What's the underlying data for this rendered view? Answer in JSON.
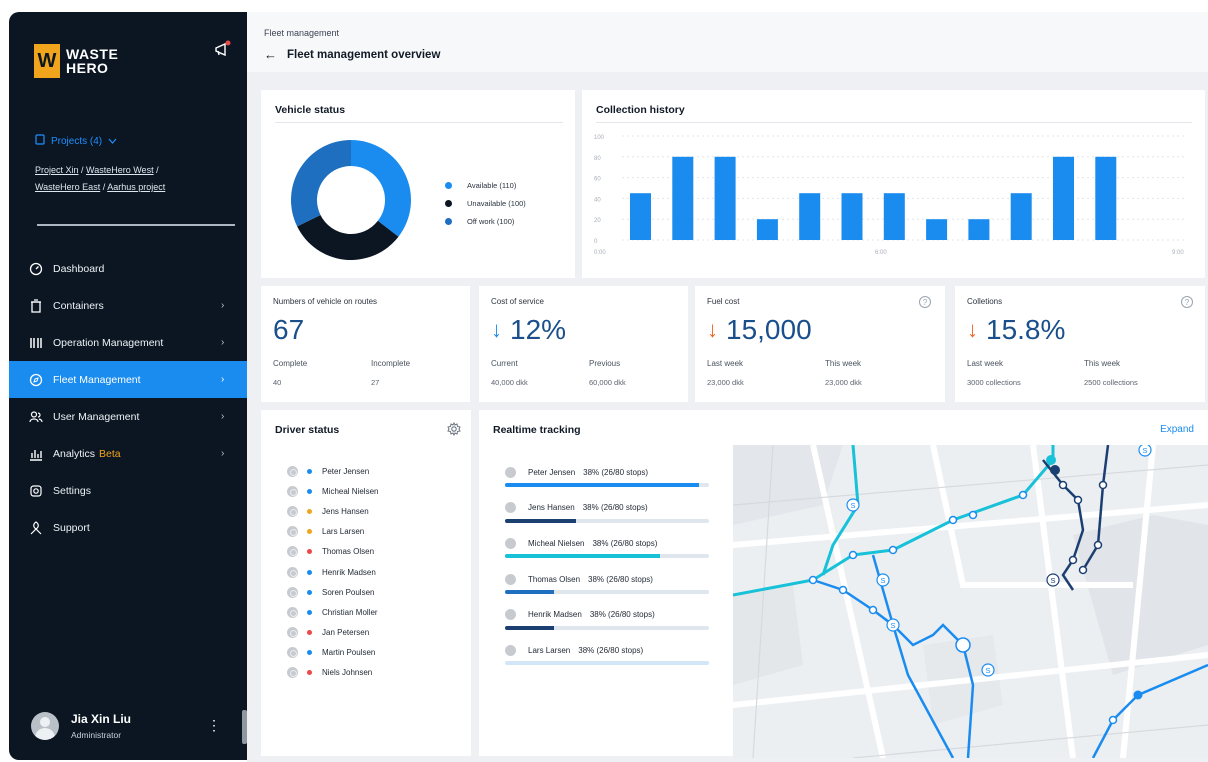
{
  "brand": {
    "logo_mark": "W",
    "logo_line1": "WASTE",
    "logo_line2": "HERO"
  },
  "sidebar": {
    "projects_label": "Projects (4)",
    "project_links": [
      "Project Xin",
      "WasteHero West",
      "WasteHero East",
      "Aarhus project"
    ],
    "items": [
      {
        "label": "Dashboard",
        "icon": "dashboard-icon"
      },
      {
        "label": "Containers",
        "icon": "container-icon",
        "chevron": "›"
      },
      {
        "label": "Operation Management",
        "icon": "operation-icon",
        "chevron": "›"
      },
      {
        "label": "Fleet Management",
        "icon": "fleet-icon",
        "chevron": "›",
        "active": true
      },
      {
        "label": "User Management",
        "icon": "users-icon",
        "chevron": "›"
      },
      {
        "label": "Analytics",
        "badge": "Beta",
        "icon": "analytics-icon",
        "chevron": "›"
      },
      {
        "label": "Settings",
        "icon": "gear-icon"
      },
      {
        "label": "Support",
        "icon": "support-icon"
      }
    ],
    "user": {
      "name": "Jia Xin Liu",
      "role": "Administrator"
    }
  },
  "header": {
    "breadcrumb": "Fleet management",
    "title": "Fleet management overview"
  },
  "vehicle_status": {
    "title": "Vehicle status",
    "legend": [
      {
        "label": "Available (110)",
        "color": "#1a8cf0",
        "value": 110
      },
      {
        "label": "Unavailable (100)",
        "color": "#0b1622",
        "value": 100
      },
      {
        "label": "Off work (100)",
        "color": "#1e6fbf",
        "value": 100
      }
    ]
  },
  "collection_history": {
    "title": "Collection history",
    "x_ticks": [
      "0:00",
      "6:00",
      "9:00"
    ]
  },
  "chart_data": {
    "type": "bar",
    "title": "Collection history",
    "ylim": [
      0,
      100
    ],
    "y_ticks": [
      0,
      20,
      40,
      60,
      80,
      100
    ],
    "values": [
      45,
      80,
      80,
      20,
      45,
      45,
      45,
      20,
      20,
      45,
      80,
      80
    ],
    "x_ticks": [
      "0:00",
      "6:00",
      "9:00"
    ],
    "grid": true,
    "color": "#1a8cf0"
  },
  "stats": {
    "vehicles": {
      "label": "Numbers of vehicle on routes",
      "value": "67",
      "k1": "Complete",
      "v1": "40",
      "k2": "Incomplete",
      "v2": "27"
    },
    "cost": {
      "label": "Cost of service",
      "value": "12%",
      "arrow": "↓",
      "k1": "Current",
      "v1": "40,000 dkk",
      "k2": "Previous",
      "v2": "60,000 dkk"
    },
    "fuel": {
      "label": "Fuel cost",
      "value": "15,000",
      "arrow": "↓",
      "k1": "Last week",
      "v1": "23,000 dkk",
      "k2": "This week",
      "v2": "23,000 dkk"
    },
    "collections": {
      "label": "Colletions",
      "value": "15.8%",
      "arrow": "↓",
      "k1": "Last week",
      "v1": "3000 collections",
      "k2": "This week",
      "v2": "2500 collections"
    }
  },
  "driver_status": {
    "title": "Driver status",
    "drivers": [
      {
        "name": "Peter Jensen",
        "color": "#1a8cf0"
      },
      {
        "name": "Micheal Nielsen",
        "color": "#1a8cf0"
      },
      {
        "name": "Jens Hansen",
        "color": "#f0a51c"
      },
      {
        "name": "Lars Larsen",
        "color": "#f0a51c"
      },
      {
        "name": "Thomas Olsen",
        "color": "#f04646"
      },
      {
        "name": "Henrik Madsen",
        "color": "#1a8cf0"
      },
      {
        "name": "Soren Poulsen",
        "color": "#1a8cf0"
      },
      {
        "name": "Christian Moller",
        "color": "#1a8cf0"
      },
      {
        "name": "Jan Petersen",
        "color": "#f04646"
      },
      {
        "name": "Martin Poulsen",
        "color": "#1a8cf0"
      },
      {
        "name": "Niels Johnsen",
        "color": "#f04646"
      }
    ]
  },
  "realtime": {
    "title": "Realtime tracking",
    "expand_label": "Expand",
    "tracks": [
      {
        "name": "Peter Jensen",
        "progress": "38% (26/80 stops)",
        "fill": 0.95,
        "color": "#1a8cf0"
      },
      {
        "name": "Jens Hansen",
        "progress": "38% (26/80 stops)",
        "fill": 0.35,
        "color": "#1c3f72"
      },
      {
        "name": "Micheal Nielsen",
        "progress": "38% (26/80 stops)",
        "fill": 0.76,
        "color": "#17c1d8"
      },
      {
        "name": "Thomas Olsen",
        "progress": "38% (26/80 stops)",
        "fill": 0.24,
        "color": "#1e6fbf"
      },
      {
        "name": "Henrik Madsen",
        "progress": "38% (26/80 stops)",
        "fill": 0.24,
        "color": "#1c3f72"
      },
      {
        "name": "Lars Larsen",
        "progress": "38% (26/80 stops)",
        "fill": 0.0,
        "color": "#8fc4f5"
      }
    ]
  },
  "colors": {
    "accent": "#1a8cf0",
    "sidebar_bg": "#0b1622",
    "down_blue": "#1a8cf0",
    "down_orange": "#f26322",
    "brand_yellow": "#f0a51c"
  }
}
